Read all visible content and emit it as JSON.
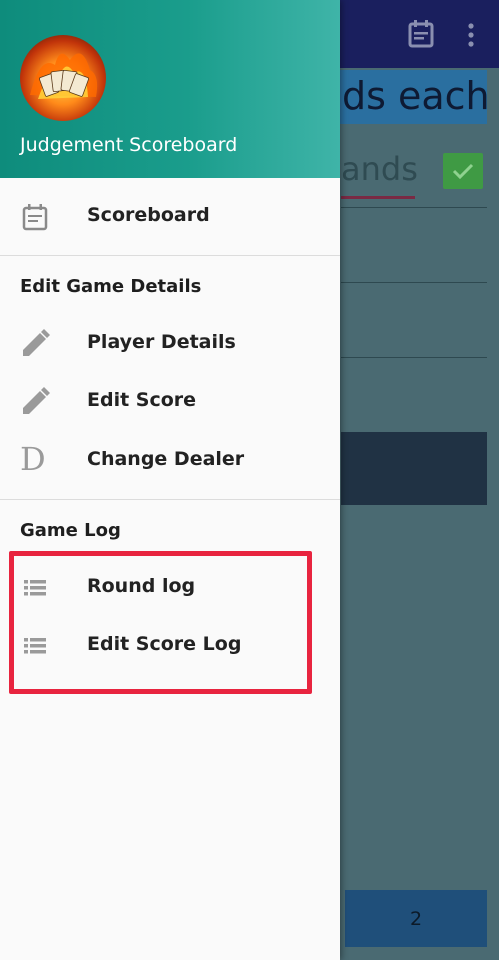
{
  "background": {
    "title_fragment": "ds each",
    "input_fragment": "ands",
    "bottom_button_label": "2"
  },
  "drawer": {
    "header": {
      "app_name": "Judgement Scoreboard"
    },
    "items": [
      {
        "label": "Scoreboard",
        "icon": "calendar-icon"
      }
    ],
    "sections": [
      {
        "title": "Edit Game Details",
        "items": [
          {
            "label": "Player Details",
            "icon": "pencil-icon"
          },
          {
            "label": "Edit Score",
            "icon": "pencil-icon"
          },
          {
            "label": "Change Dealer",
            "icon": "letter-d-icon",
            "glyph": "D"
          }
        ]
      },
      {
        "title": "Game Log",
        "items": [
          {
            "label": "Round log",
            "icon": "list-icon"
          },
          {
            "label": "Edit Score Log",
            "icon": "list-icon"
          }
        ]
      }
    ]
  },
  "colors": {
    "header_gradient_start": "#0e8c7c",
    "header_gradient_end": "#3fb4a8",
    "highlight": "#e8243f",
    "scrim_background": "#4a6a72",
    "app_bar": "#1a1f5e"
  }
}
